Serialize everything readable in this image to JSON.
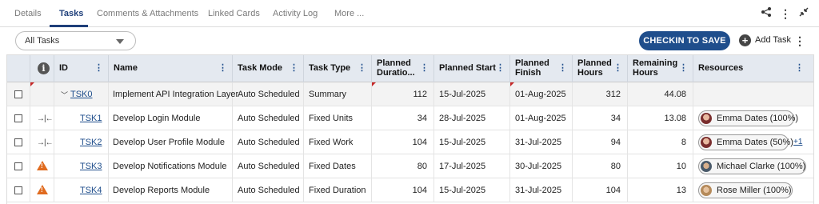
{
  "tabs": [
    {
      "label": "Details"
    },
    {
      "label": "Tasks"
    },
    {
      "label": "Comments & Attachments"
    },
    {
      "label": "Linked Cards"
    },
    {
      "label": "Activity Log"
    },
    {
      "label": "More ..."
    }
  ],
  "header_icons": [
    "share-icon",
    "kebab-icon",
    "collapse-icon"
  ],
  "toolbar": {
    "filter_value": "All Tasks",
    "checkin_label": "CHECKIN TO SAVE",
    "add_task_label": "Add Task"
  },
  "grid": {
    "columns": [
      {
        "label": ""
      },
      {
        "label": ""
      },
      {
        "label": "ID"
      },
      {
        "label": "Name"
      },
      {
        "label": "Task Mode"
      },
      {
        "label": "Task Type"
      },
      {
        "label": "Planned Duratio..."
      },
      {
        "label": "Planned Start"
      },
      {
        "label": "Planned Finish"
      },
      {
        "label": "Planned Hours"
      },
      {
        "label": "Remaining Hours"
      },
      {
        "label": "Resources"
      }
    ],
    "column_split": {
      "planned_duration": [
        "Planned",
        "Duratio..."
      ],
      "planned_finish": [
        "Planned",
        "Finish"
      ],
      "planned_hours": [
        "Planned",
        "Hours"
      ],
      "remaining_hours": [
        "Remaining",
        "Hours"
      ]
    },
    "rows": [
      {
        "id": "TSK0",
        "name": "Implement API Integration Layer",
        "mode": "Auto Scheduled",
        "type": "Summary",
        "duration": "112",
        "start": "15-Jul-2025",
        "finish": "01-Aug-2025",
        "hours": "312",
        "remaining": "44.08",
        "resource": "",
        "more": ""
      },
      {
        "id": "TSK1",
        "name": "Develop Login Module",
        "mode": "Auto Scheduled",
        "type": "Fixed Units",
        "duration": "34",
        "start": "28-Jul-2025",
        "finish": "01-Aug-2025",
        "hours": "34",
        "remaining": "13.08",
        "resource": "Emma Dates (100%)",
        "more": ""
      },
      {
        "id": "TSK2",
        "name": "Develop User Profile Module",
        "mode": "Auto Scheduled",
        "type": "Fixed Work",
        "duration": "104",
        "start": "15-Jul-2025",
        "finish": "31-Jul-2025",
        "hours": "94",
        "remaining": "8",
        "resource": "Emma Dates (50%)",
        "more": "+1"
      },
      {
        "id": "TSK3",
        "name": "Develop Notifications Module",
        "mode": "Auto Scheduled",
        "type": "Fixed Dates",
        "duration": "80",
        "start": "17-Jul-2025",
        "finish": "30-Jul-2025",
        "hours": "80",
        "remaining": "10",
        "resource": "Michael Clarke (100%)",
        "more": ""
      },
      {
        "id": "TSK4",
        "name": "Develop Reports Module",
        "mode": "Auto Scheduled",
        "type": "Fixed Duration",
        "duration": "104",
        "start": "15-Jul-2025",
        "finish": "31-Jul-2025",
        "hours": "104",
        "remaining": "13",
        "resource": "Rose Miller (100%)",
        "more": ""
      }
    ],
    "row_icons": [
      "expand-caret",
      "dependency-icon",
      "dependency-icon",
      "warning-icon",
      "warning-icon"
    ]
  },
  "colors": {
    "accent": "#1f4e8c",
    "header_bg": "#e4e9f0",
    "warning": "#e06b1f",
    "flag": "#c62828"
  }
}
